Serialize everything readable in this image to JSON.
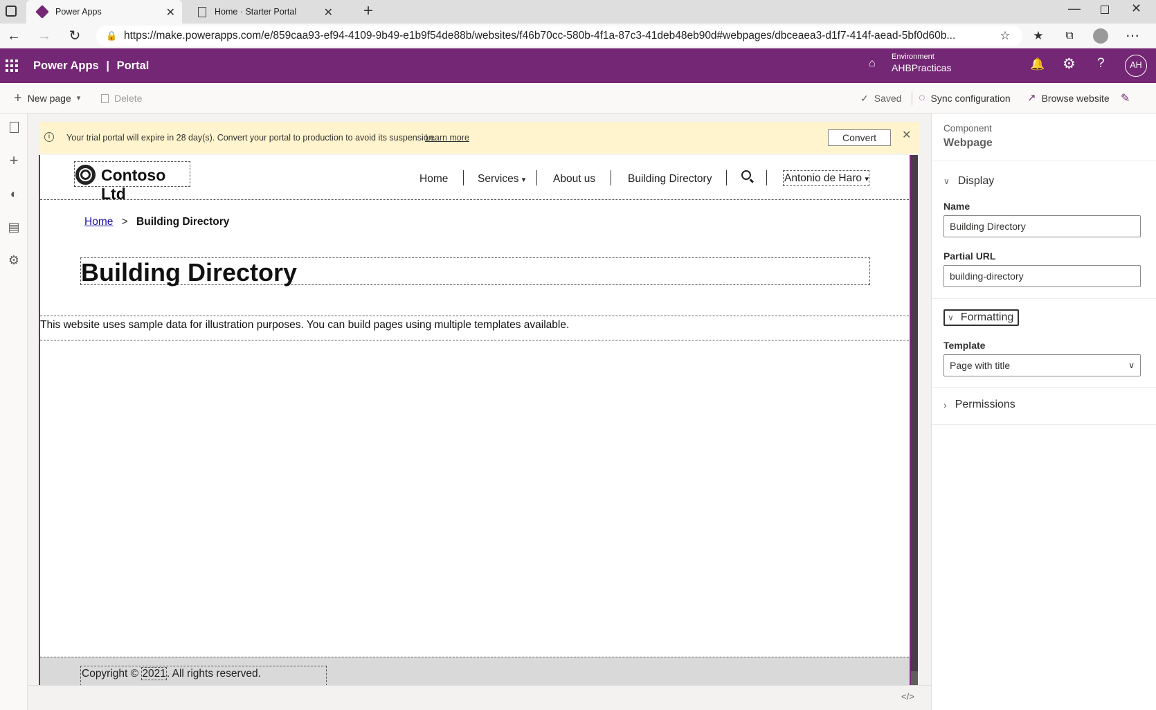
{
  "browser": {
    "tabs": [
      {
        "label": "Power Apps"
      },
      {
        "label": "Home · Starter Portal"
      }
    ],
    "url": "https://make.powerapps.com/e/859caa93-ef94-4109-9b49-e1b9f54de88b/websites/f46b70cc-580b-4f1a-87c3-41deb48eb90d#webpages/dbceaea3-d1f7-414f-aead-5bf0d60b..."
  },
  "appbar": {
    "app_name": "Power Apps",
    "separator": "|",
    "section": "Portal",
    "environment_label": "Environment",
    "environment_name": "AHBPracticas",
    "avatar_initials": "AH",
    "brand_color": "#742774"
  },
  "commandbar": {
    "new_page": "New page",
    "delete": "Delete",
    "saved": "Saved",
    "sync": "Sync configuration",
    "browse": "Browse website"
  },
  "banner": {
    "message": "Your trial portal will expire in 28 day(s). Convert your portal to production to avoid its suspension.",
    "link": "Learn more",
    "convert": "Convert"
  },
  "site": {
    "logo_text": "Contoso Ltd",
    "nav": [
      "Home",
      "Services",
      "About us",
      "Building Directory"
    ],
    "user": "Antonio de Haro",
    "breadcrumb_home": "Home",
    "breadcrumb_sep": ">",
    "breadcrumb_current": "Building Directory",
    "page_title": "Building Directory",
    "body_text": "This website uses sample data for illustration purposes. You can build pages using multiple templates available.",
    "footer_prefix": "Copyright ©",
    "footer_year": "2021",
    "footer_suffix": ". All rights reserved."
  },
  "panel": {
    "component_label": "Component",
    "component_type": "Webpage",
    "display_section": "Display",
    "name_label": "Name",
    "name_value": "Building Directory",
    "partial_url_label": "Partial URL",
    "partial_url_value": "building-directory",
    "formatting_section": "Formatting",
    "template_label": "Template",
    "template_value": "Page with title",
    "permissions_section": "Permissions"
  },
  "footer_bar": {
    "code_toggle": "</>"
  }
}
